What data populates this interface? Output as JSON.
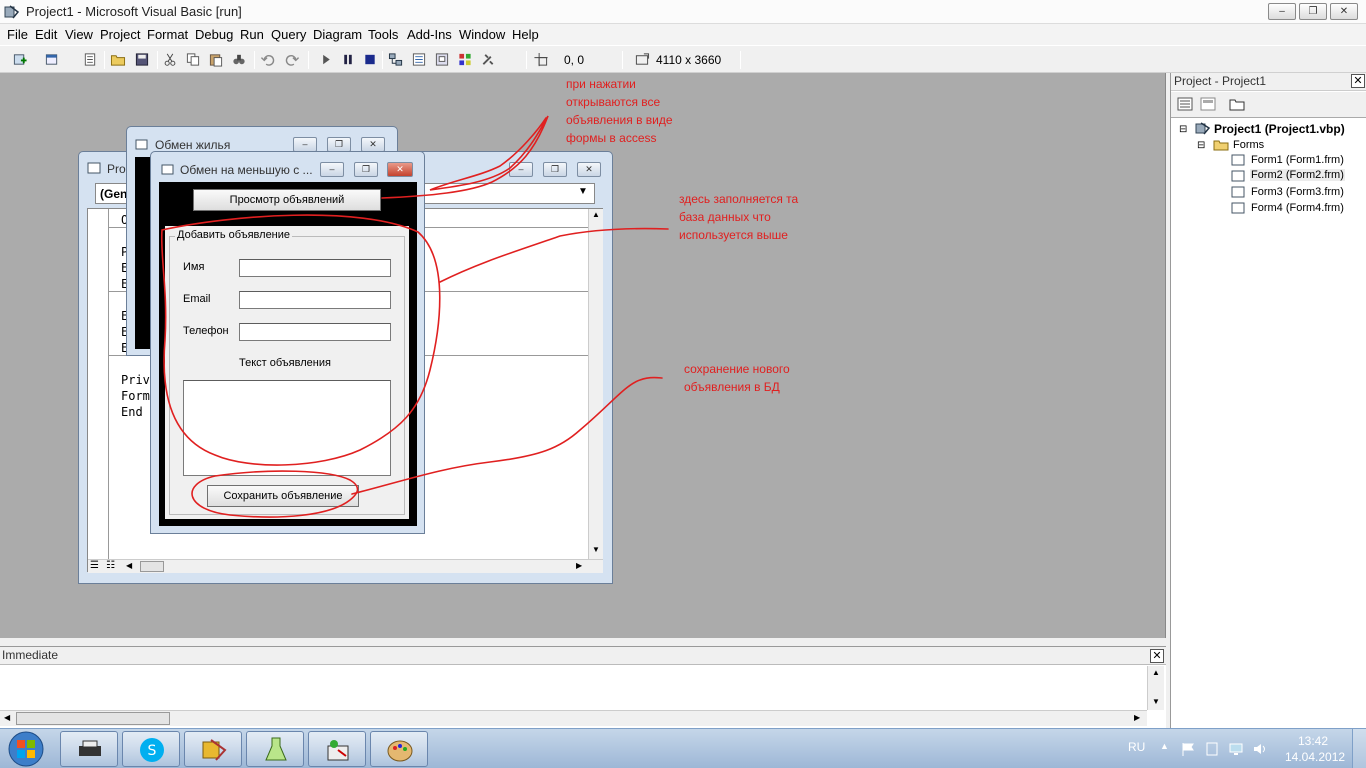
{
  "window": {
    "title": "Project1 - Microsoft Visual Basic [run]",
    "controls": [
      "–",
      "❐",
      "✕"
    ]
  },
  "menu": [
    "File",
    "Edit",
    "View",
    "Project",
    "Format",
    "Debug",
    "Run",
    "Query",
    "Diagram",
    "Tools",
    "Add-Ins",
    "Window",
    "Help"
  ],
  "toolbar": {
    "position": "0, 0",
    "size": "4110 x 3660"
  },
  "project_pane": {
    "title": "Project - Project1",
    "close": "✕",
    "root": "Project1 (Project1.vbp)",
    "folder": "Forms",
    "forms": [
      "Form1 (Form1.frm)",
      "Form2 (Form2.frm)",
      "Form3 (Form3.frm)",
      "Form4 (Form4.frm)"
    ]
  },
  "immediate": {
    "title": "Immediate",
    "close": "✕"
  },
  "code_window": {
    "title": "Pro",
    "combo_left": "(Gen",
    "lines_top": [
      "O"
    ],
    "lines_mid1": [
      "P",
      "E",
      "E"
    ],
    "lines_mid2": [
      "E",
      "E",
      "E"
    ],
    "lines_bottom": [
      "Priv",
      "Form",
      "End"
    ]
  },
  "window_back": {
    "title": "Обмен жилья"
  },
  "window_front": {
    "title": "Обмен на меньшую с ...",
    "view_button": "Просмотр объявлений",
    "group_title": "Добавить объявление",
    "label_name": "Имя",
    "label_email": "Email",
    "label_phone": "Телефон",
    "label_text": "Текст объявления",
    "save_button": "Сохранить объявление"
  },
  "annotations": {
    "note1": "при нажатии\nоткрываются все\nобъявления в виде\nформы в access",
    "note2": "здесь заполняется та\nбаза данных что\nиспользуется выше",
    "note3": "сохранение нового\nобъявления в БД"
  },
  "tray": {
    "lang": "RU",
    "time": "13:42",
    "date": "14.04.2012"
  },
  "colors": {
    "annotation": "#e02020",
    "mdi_bg": "#ababab"
  }
}
